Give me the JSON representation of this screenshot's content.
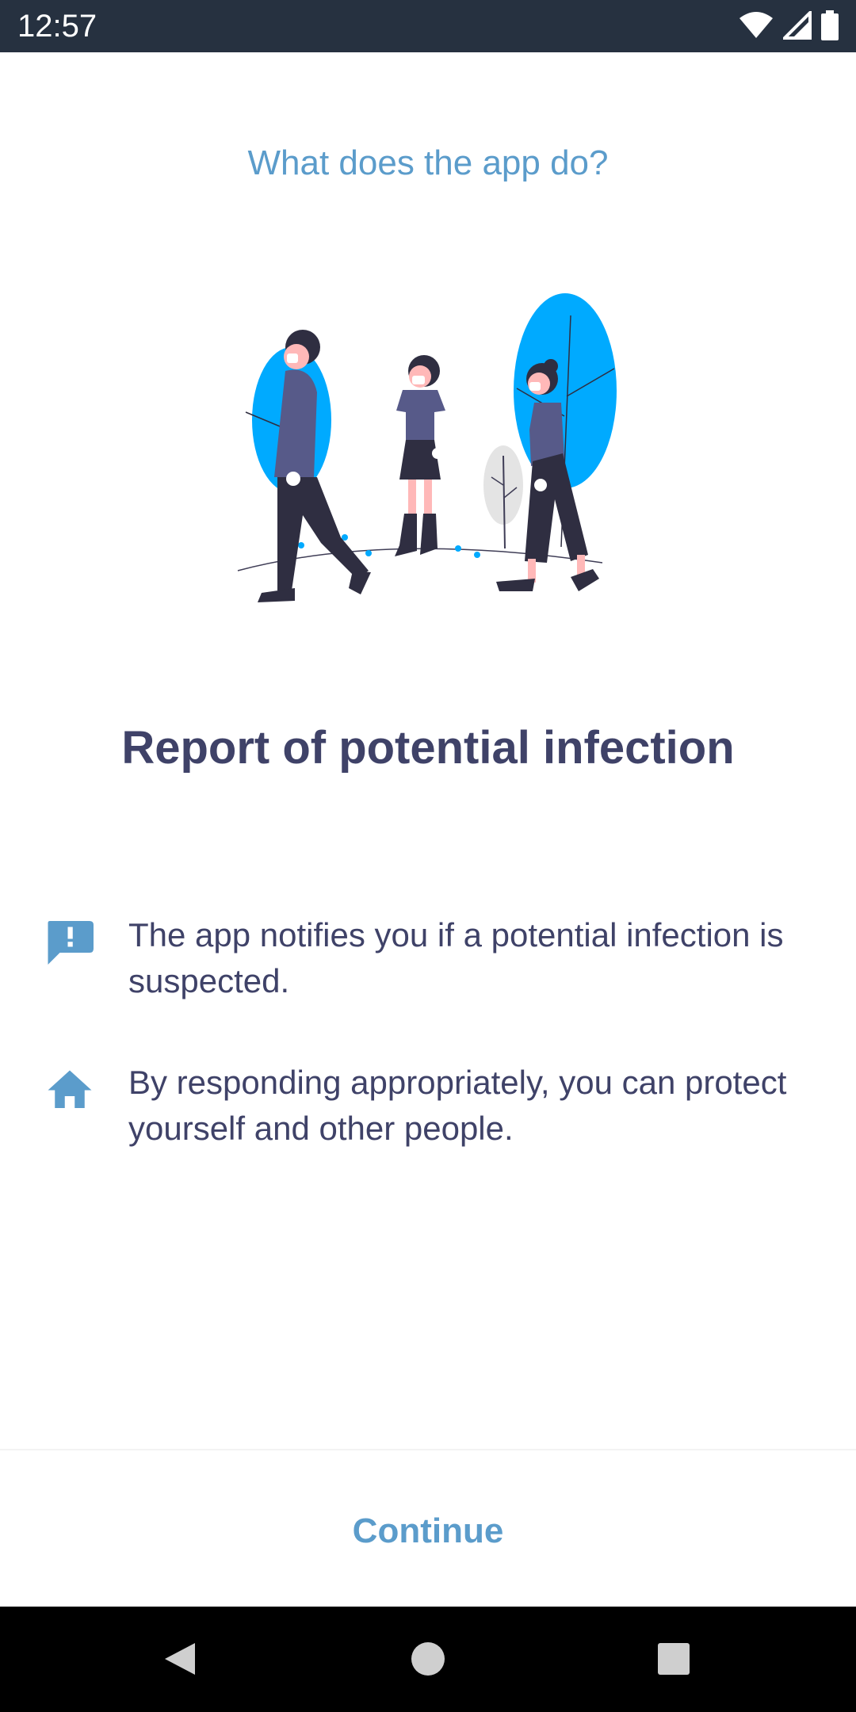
{
  "status_bar": {
    "time": "12:57",
    "icons": [
      "wifi-icon",
      "cell-signal-icon",
      "battery-icon"
    ],
    "background": "#263140"
  },
  "onboarding": {
    "subtitle": "What does the app do?",
    "title": "Report of potential infection",
    "features": [
      {
        "icon": "message-alert-icon",
        "text": "The app notifies you if a potential infection is suspected."
      },
      {
        "icon": "home-icon",
        "text": "By responding appropriately, you can protect yourself and other people."
      }
    ],
    "continue_label": "Continue"
  },
  "colors": {
    "accent": "#5b9ccb",
    "title": "#3f4268",
    "illustration_blue": "#00aaff"
  },
  "nav_bar": {
    "buttons": [
      "back-icon",
      "home-circle-icon",
      "recents-icon"
    ]
  }
}
